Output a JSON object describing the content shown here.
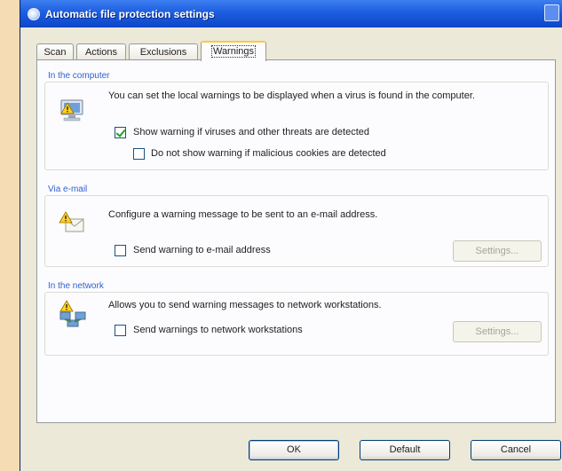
{
  "window": {
    "title": "Automatic file protection settings"
  },
  "tabs": [
    {
      "label": "Scan"
    },
    {
      "label": "Actions"
    },
    {
      "label": "Exclusions"
    },
    {
      "label": "Warnings",
      "active": true
    }
  ],
  "computer_group": {
    "label": "In the computer",
    "description": "You can set the local warnings to be displayed when a virus is found in the computer.",
    "checkbox1": {
      "label": "Show warning if viruses and other threats are detected",
      "checked": true
    },
    "checkbox2": {
      "label": "Do not show warning if malicious cookies are detected",
      "checked": false
    }
  },
  "email_group": {
    "label": "Via e-mail",
    "description": "Configure a warning message to be sent to an e-mail address.",
    "checkbox": {
      "label": "Send warning to e-mail address",
      "checked": false
    },
    "settings_button": "Settings..."
  },
  "network_group": {
    "label": "In the network",
    "description": "Allows you to send warning messages to network workstations.",
    "checkbox": {
      "label": "Send warnings to network workstations",
      "checked": false
    },
    "settings_button": "Settings..."
  },
  "buttons": {
    "ok": "OK",
    "default": "Default",
    "cancel": "Cancel"
  },
  "colors": {
    "titlebar": "#1d5de0",
    "background": "#ece9d8",
    "page_margin": "#f6dcb4",
    "group_label": "#2f5fd0"
  },
  "icons": [
    "app-icon",
    "computer-warning-icon",
    "email-warning-icon",
    "network-warning-icon"
  ]
}
